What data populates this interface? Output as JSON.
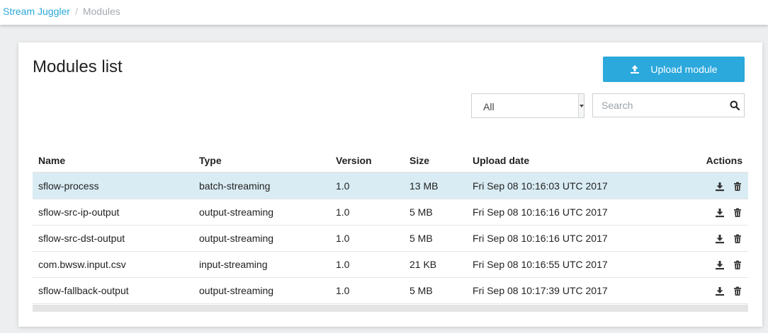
{
  "breadcrumb": {
    "root": "Stream Juggler",
    "separator": "/",
    "current": "Modules"
  },
  "page": {
    "title": "Modules list"
  },
  "toolbar": {
    "upload_label": "Upload module",
    "upload_icon": "upload-icon",
    "filter_selected": "All",
    "search_placeholder": "Search",
    "search_icon": "search-icon"
  },
  "table": {
    "headers": {
      "name": "Name",
      "type": "Type",
      "version": "Version",
      "size": "Size",
      "upload_date": "Upload date",
      "actions": "Actions"
    },
    "rows": [
      {
        "name": "sflow-process",
        "type": "batch-streaming",
        "version": "1.0",
        "size": "13 MB",
        "upload_date": "Fri Sep 08 10:16:03 UTC 2017",
        "selected": true
      },
      {
        "name": "sflow-src-ip-output",
        "type": "output-streaming",
        "version": "1.0",
        "size": "5 MB",
        "upload_date": "Fri Sep 08 10:16:16 UTC 2017",
        "selected": false
      },
      {
        "name": "sflow-src-dst-output",
        "type": "output-streaming",
        "version": "1.0",
        "size": "5 MB",
        "upload_date": "Fri Sep 08 10:16:16 UTC 2017",
        "selected": false
      },
      {
        "name": "com.bwsw.input.csv",
        "type": "input-streaming",
        "version": "1.0",
        "size": "21 KB",
        "upload_date": "Fri Sep 08 10:16:55 UTC 2017",
        "selected": false
      },
      {
        "name": "sflow-fallback-output",
        "type": "output-streaming",
        "version": "1.0",
        "size": "5 MB",
        "upload_date": "Fri Sep 08 10:17:39 UTC 2017",
        "selected": false
      }
    ],
    "row_actions": [
      "download-icon",
      "trash-icon"
    ]
  },
  "colors": {
    "accent": "#2ba8dc",
    "link": "#2aa8d8",
    "selected_row": "#d9ecf4"
  }
}
